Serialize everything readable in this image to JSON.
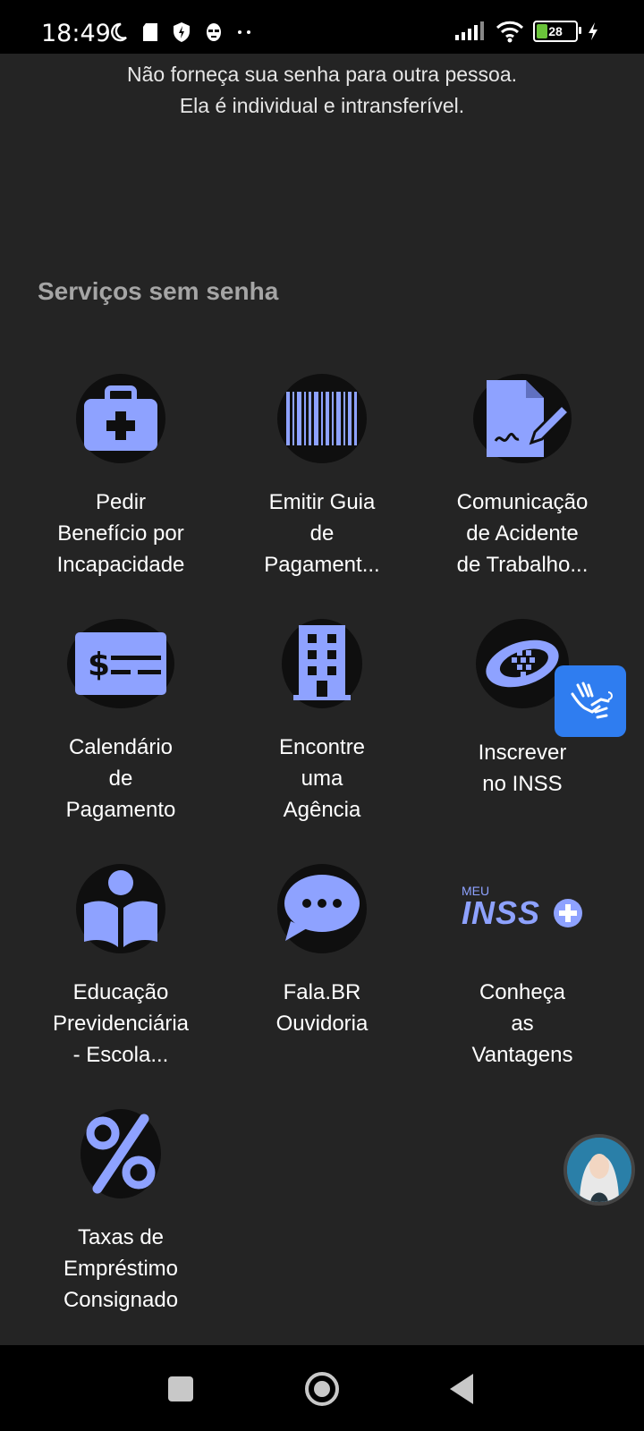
{
  "status": {
    "time": "18:49",
    "battery": "28"
  },
  "warning": {
    "line1": "Não forneça sua senha para outra pessoa.",
    "line2": "Ela é individual e intransferível."
  },
  "section_title": "Serviços sem senha",
  "tiles": [
    {
      "label_lines": [
        "Pedir",
        "Benefício por",
        "Incapacidade"
      ],
      "icon": "medical-kit-icon"
    },
    {
      "label_lines": [
        "Emitir Guia",
        "de",
        "Pagament..."
      ],
      "icon": "barcode-icon"
    },
    {
      "label_lines": [
        "Comunicação",
        "de Acidente",
        "de Trabalho..."
      ],
      "icon": "document-sign-icon"
    },
    {
      "label_lines": [
        "Calendário",
        "de",
        "Pagamento"
      ],
      "icon": "money-check-icon"
    },
    {
      "label_lines": [
        "Encontre",
        "uma",
        "Agência"
      ],
      "icon": "building-icon"
    },
    {
      "label_lines": [
        "Inscrever",
        "no INSS"
      ],
      "icon": "inss-logo-icon"
    },
    {
      "label_lines": [
        "Educação",
        "Previdenciária",
        "- Escola..."
      ],
      "icon": "education-icon"
    },
    {
      "label_lines": [
        "Fala.BR",
        "Ouvidoria"
      ],
      "icon": "chat-bubble-icon"
    },
    {
      "label_lines": [
        "Conheça",
        "as",
        "Vantagens"
      ],
      "icon": "meu-inss-plus-logo",
      "logo_small": "MEU",
      "logo_big": "INSS"
    },
    {
      "label_lines": [
        "Taxas de",
        "Empréstimo",
        "Consignado"
      ],
      "icon": "percent-icon"
    }
  ],
  "colors": {
    "accent": "#8ea2ff",
    "background": "#242424",
    "icon_circle": "#0f0f0f",
    "libras_button": "#2f7df0"
  }
}
